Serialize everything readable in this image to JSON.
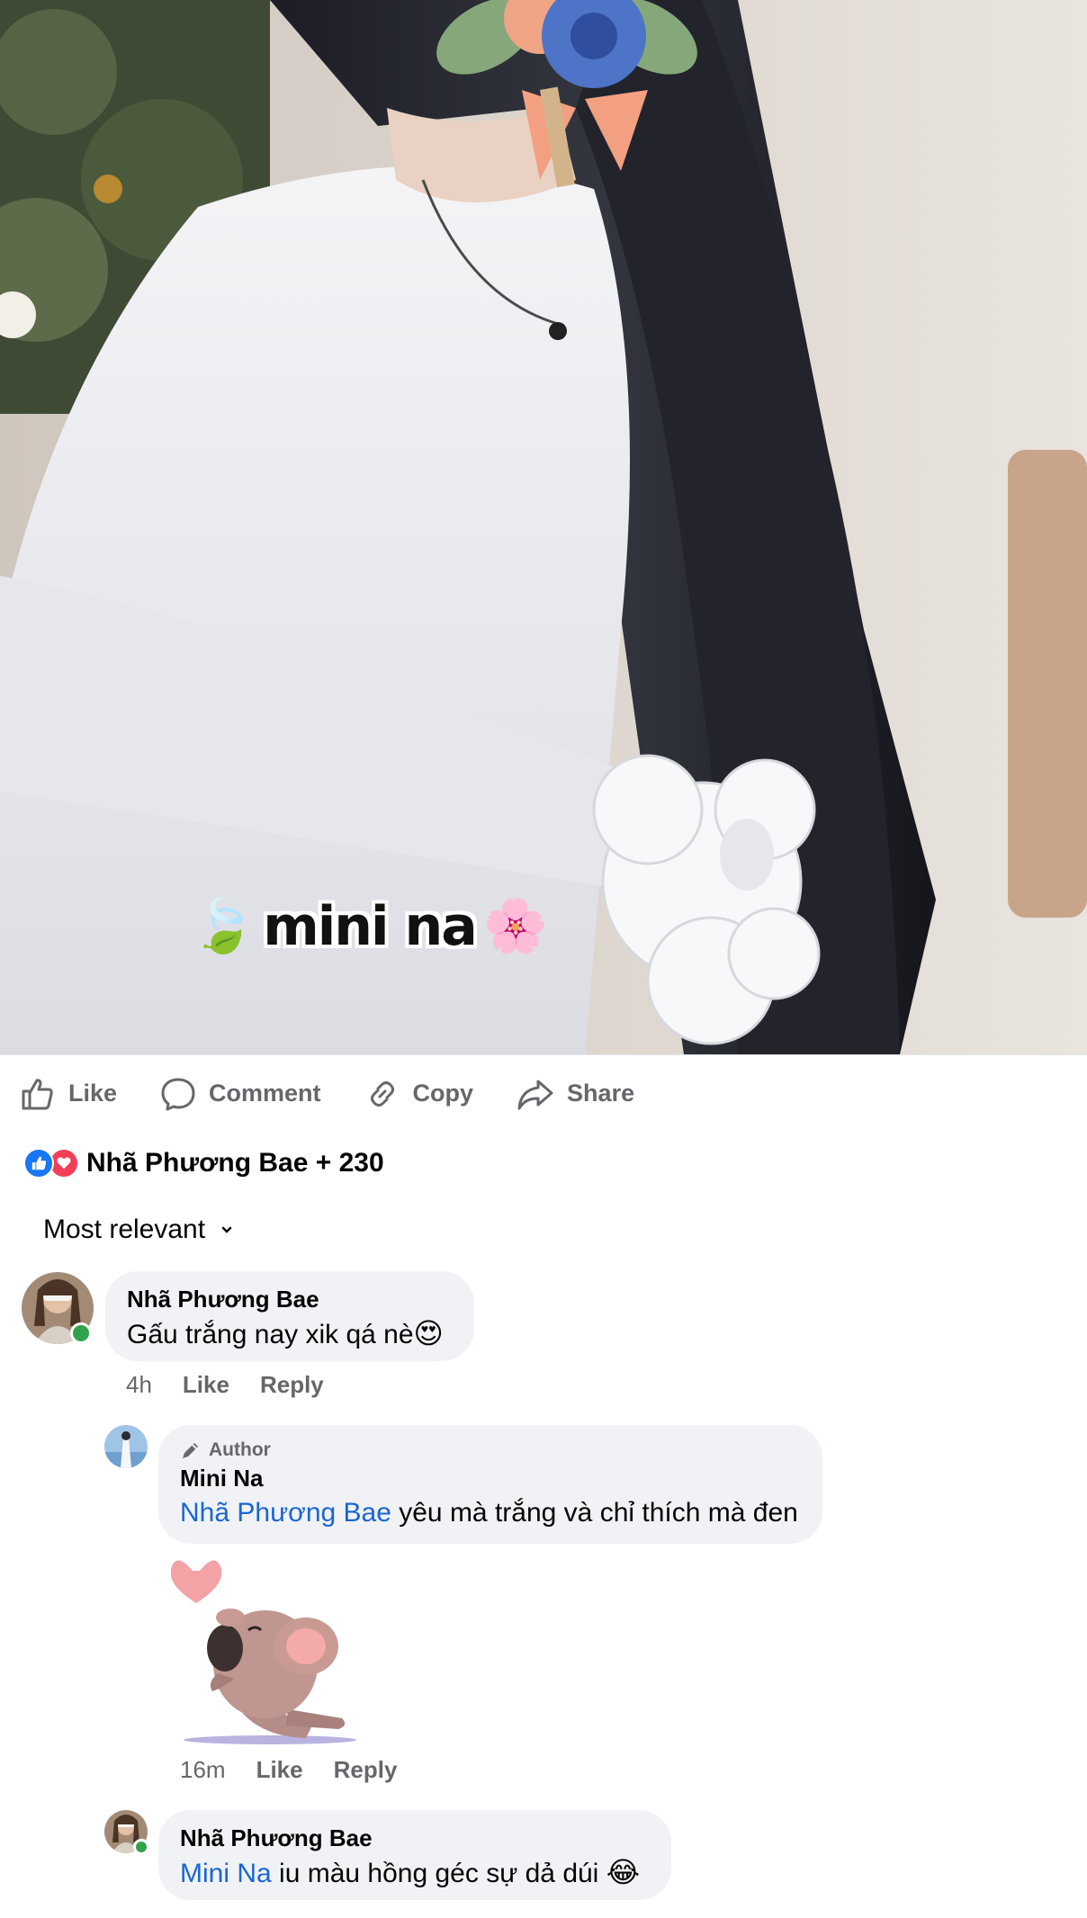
{
  "photo": {
    "caption_leaf_emoji": "🍃",
    "caption_text": "mini na",
    "caption_flower_emoji": "🌸"
  },
  "actions": {
    "like": "Like",
    "comment": "Comment",
    "copy": "Copy",
    "share": "Share"
  },
  "reactions": {
    "summary": "Nhã Phương Bae + 230",
    "icons": [
      "like-reaction-icon",
      "love-reaction-icon"
    ]
  },
  "sort": {
    "label": "Most relevant"
  },
  "comments": [
    {
      "name": "Nhã Phương Bae",
      "text": "Gấu trắng nay xik qá nè",
      "emoji": "😍",
      "time": "4h",
      "like": "Like",
      "reply": "Reply",
      "online": true
    },
    {
      "author_badge": "Author",
      "name": "Mini Na",
      "mention": "Nhã Phương Bae",
      "text": " yêu mà trắng và chỉ thích mà đen",
      "sticker": "koala-blowing-kiss-heart-sticker",
      "time": "16m",
      "like": "Like",
      "reply": "Reply"
    },
    {
      "name": "Nhã Phương Bae",
      "mention": "Mini Na",
      "text": " iu màu hồng géc sự dả dúi ",
      "emoji": "😂",
      "online": true
    }
  ],
  "colors": {
    "accent_blue": "#1877f2",
    "mention_blue": "#1a66d2",
    "love_red": "#f33e58",
    "bubble_gray": "#f0f2f5",
    "meta_gray": "#65676b",
    "online_green": "#31a24c"
  }
}
